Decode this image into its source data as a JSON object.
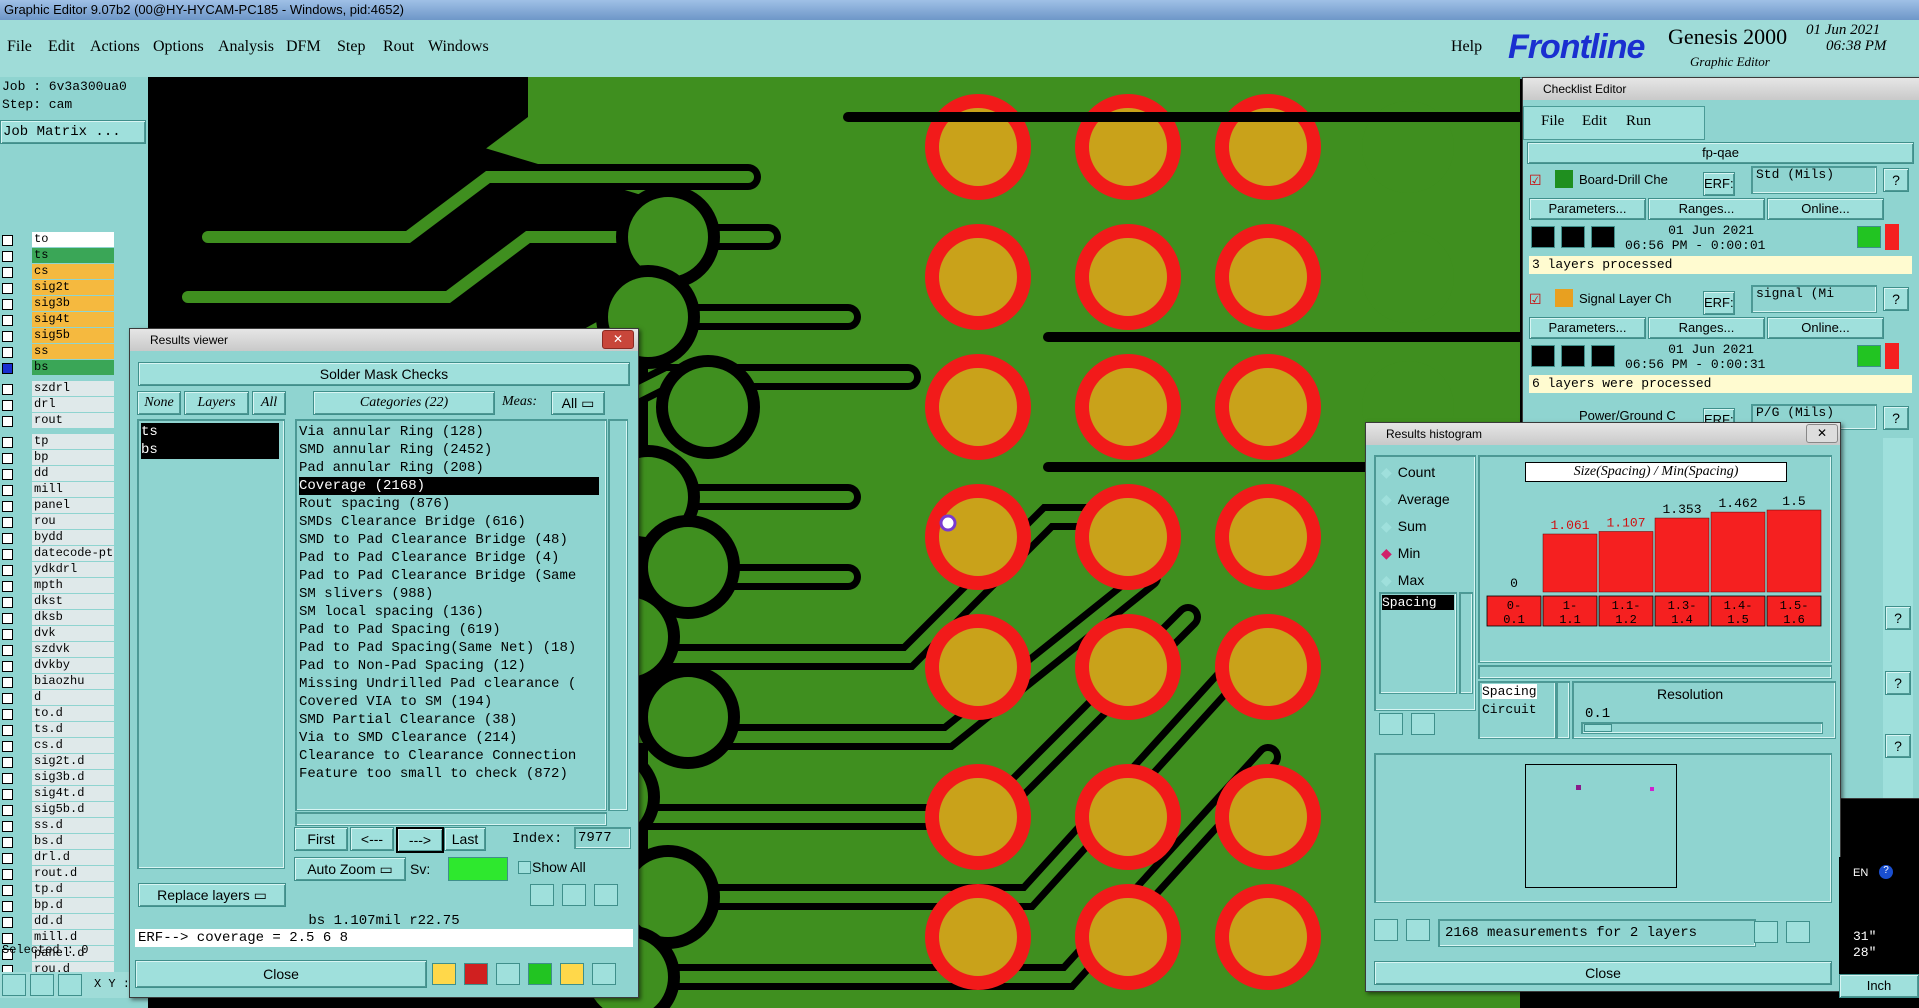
{
  "window_title": "Graphic Editor 9.07b2 (00@HY-HYCAM-PC185 - Windows, pid:4652)",
  "menubar": [
    "File",
    "Edit",
    "Actions",
    "Options",
    "Analysis",
    "DFM",
    "Step",
    "Rout",
    "Windows"
  ],
  "help": "Help",
  "brand": {
    "logo": "Frontline",
    "product": "Genesis 2000",
    "subtitle": "Graphic Editor",
    "date": "01 Jun 2021",
    "time": "06:38 PM"
  },
  "left": {
    "job": "Job : 6v3a300ua0",
    "step": "Step: cam",
    "job_matrix": "Job Matrix ...",
    "layers_a": [
      {
        "name": "to",
        "color": "#ffffff"
      },
      {
        "name": "ts",
        "color": "#3aa657"
      },
      {
        "name": "cs",
        "color": "#f5b93f"
      },
      {
        "name": "sig2t",
        "color": "#f5b93f"
      },
      {
        "name": "sig3b",
        "color": "#f5b93f"
      },
      {
        "name": "sig4t",
        "color": "#f5b93f"
      },
      {
        "name": "sig5b",
        "color": "#f5b93f"
      },
      {
        "name": "ss",
        "color": "#f5b93f"
      },
      {
        "name": "bs",
        "color": "#3aa657",
        "selected": true
      }
    ],
    "layers_b": [
      "szdrl",
      "drl",
      "rout"
    ],
    "layers_c": [
      "tp",
      "bp",
      "dd",
      "mill",
      "panel",
      "rou",
      "bydd",
      "datecode-pt",
      "ydkdrl",
      "mpth",
      "dkst",
      "dksb",
      "dvk",
      "szdvk",
      "dvkby",
      "biaozhu",
      "d",
      "to.d",
      "ts.d",
      "cs.d",
      "sig2t.d",
      "sig3b.d",
      "sig4t.d",
      "sig5b.d",
      "ss.d",
      "bs.d",
      "drl.d",
      "rout.d",
      "tp.d",
      "bp.d",
      "dd.d",
      "mill.d",
      "panel.d",
      "rou.d"
    ],
    "selected": "Selected : 0",
    "xy": "X Y :"
  },
  "results_viewer": {
    "title": "Results viewer",
    "header": "Solder Mask Checks",
    "none": "None",
    "layers": "Layers",
    "all": "All",
    "categories": "Categories (22)",
    "meas_label": "Meas:",
    "meas_value": "All",
    "layer_list": [
      "ts",
      "bs"
    ],
    "items": [
      "Via annular Ring (128)",
      "SMD annular Ring (2452)",
      "Pad annular Ring (208)",
      "Coverage (2168)",
      "Rout spacing (876)",
      "SMDs Clearance Bridge (616)",
      "SMD to Pad Clearance Bridge (48)",
      "Pad to Pad Clearance Bridge (4)",
      "Pad to Pad Clearance Bridge (Same",
      "SM slivers (988)",
      "SM local spacing (136)",
      "Pad to Pad Spacing (619)",
      "Pad to Pad Spacing(Same Net) (18)",
      "Pad to Non-Pad Spacing (12)",
      "Missing Undrilled Pad clearance (",
      "Covered VIA to SM (194)",
      "SMD Partial Clearance (38)",
      "Via to SMD Clearance (214)",
      "Clearance to Clearance Connection",
      "Feature too small to check (872)"
    ],
    "selected_index": 3,
    "first": "First",
    "prev": "<---",
    "next": "--->",
    "last": "Last",
    "index_label": "Index:",
    "index_value": "7977",
    "auto_zoom": "Auto Zoom",
    "sv": "Sv:",
    "show_all": "Show All",
    "replace_layers": "Replace layers",
    "status": "bs 1.107mil  r22.75",
    "erf": "ERF--> coverage = 2.5 6 8",
    "close": "Close"
  },
  "checklist": {
    "title": "Checklist Editor",
    "menu": [
      "File",
      "Edit",
      "Run"
    ],
    "name": "fp-qae",
    "items": [
      {
        "name": "Board-Drill Che",
        "erf": "ERF:",
        "erf_value": "Std (Mils)",
        "date": "01 Jun 2021",
        "time": "06:56 PM - 0:00:01",
        "status": "3 layers processed"
      },
      {
        "name": "Signal Layer Ch",
        "erf": "ERF:",
        "erf_value": "signal (Mi",
        "date": "01 Jun 2021",
        "time": "06:56 PM - 0:00:31",
        "status": "6 layers were processed"
      },
      {
        "name": "Power/Ground C",
        "erf": "ERF:",
        "erf_value": "P/G (Mils)"
      }
    ],
    "parameters": "Parameters...",
    "ranges": "Ranges...",
    "online": "Online..."
  },
  "histogram": {
    "title": "Results histogram",
    "modes": [
      "Count",
      "Average",
      "Sum",
      "Min",
      "Max"
    ],
    "selected_mode": "Min",
    "chart_title": "Size(Spacing) / Min(Spacing)",
    "list": [
      "Spacing"
    ],
    "spacing_circuit": [
      "Spacing",
      "Circuit"
    ],
    "resolution_label": "Resolution",
    "resolution_value": "0.1",
    "measurements": "2168 measurements for 2 layers",
    "close": "Close"
  },
  "chart_data": {
    "type": "bar",
    "title": "Size(Spacing) / Min(Spacing)",
    "categories": [
      "0-0.1",
      "1-1.1",
      "1.1-1.2",
      "1.3-1.4",
      "1.4-1.5",
      "1.5-1.6"
    ],
    "values": [
      0,
      1.061,
      1.107,
      1.353,
      1.462,
      1.5
    ],
    "value_labels": [
      "0",
      "1.061",
      "1.107",
      "1.353",
      "1.462",
      "1.5"
    ]
  },
  "right_edge": {
    "lang": "EN",
    "inch": "Inch",
    "v1": "31\"",
    "v2": "28\""
  },
  "colors": {
    "bg": "#8fd4d0",
    "copper": "#3f8f1f",
    "pad": "#c9a21a",
    "ring": "#f21a1a",
    "bar": "#f52020"
  }
}
